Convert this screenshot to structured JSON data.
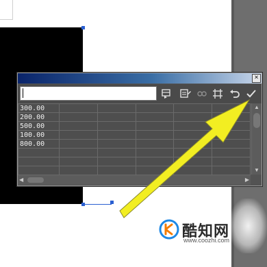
{
  "dialog": {
    "close_label": "×",
    "input_value": "",
    "toolbar_icons": [
      "insert-row-icon",
      "edit-icon",
      "disabled-link-icon",
      "table-structure-icon",
      "undo-icon",
      "checkmark-icon"
    ]
  },
  "grid": {
    "rows": [
      [
        "300.00",
        "",
        "",
        "",
        "",
        ""
      ],
      [
        "200.00",
        "",
        "",
        "",
        "",
        ""
      ],
      [
        "500.00",
        "",
        "",
        "",
        "",
        ""
      ],
      [
        "100.00",
        "",
        "",
        "",
        "",
        ""
      ],
      [
        "800.00",
        "",
        "",
        "",
        "",
        ""
      ],
      [
        "",
        "",
        "",
        "",
        "",
        ""
      ],
      [
        "",
        "",
        "",
        "",
        "",
        ""
      ],
      [
        "",
        "",
        "",
        "",
        "",
        ""
      ]
    ]
  },
  "watermark": {
    "name": "酷知网",
    "url": "www.coozhi.com"
  },
  "colors": {
    "arrow": "#f2ee22",
    "dialog_bg": "#535353",
    "title_start": "#0a246a",
    "handle": "#2a5fd1"
  }
}
